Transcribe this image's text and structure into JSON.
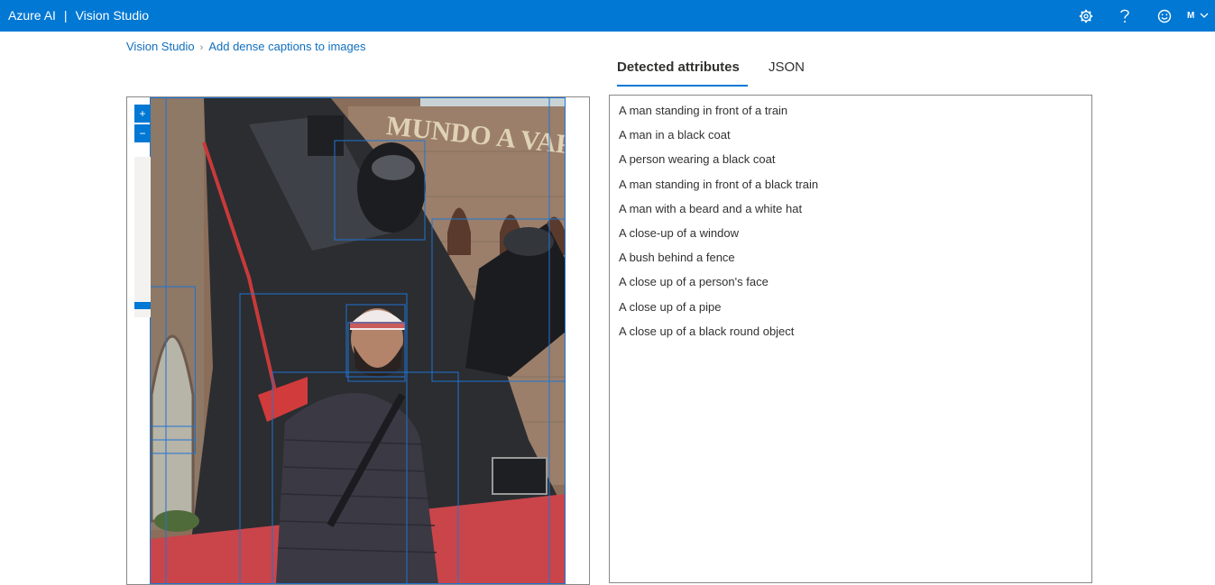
{
  "header": {
    "brand": "Azure AI",
    "separator": "|",
    "product": "Vision Studio",
    "icons": [
      "gear-icon",
      "help-icon",
      "feedback-smiley-icon",
      "chevron-down-icon"
    ],
    "avatar_initial": "M",
    "background_color": "#0078d4"
  },
  "breadcrumb": {
    "items": [
      "Vision Studio",
      "Add dense captions to images"
    ],
    "separator": "›"
  },
  "tabs": {
    "detected": "Detected attributes",
    "json": "JSON",
    "active": "Detected attributes"
  },
  "viewer": {
    "zoom_in_icon": "+",
    "zoom_out_icon": "−",
    "image_sign_text": "MUNDO A VAPOR"
  },
  "captions": [
    "A man standing in front of a train",
    "A man in a black coat",
    "A person wearing a black coat",
    "A man standing in front of a black train",
    "A man with a beard and a white hat",
    "A close-up of a window",
    "A bush behind a fence",
    "A close up of a person's face",
    "A close up of a pipe",
    "A close up of a black round object"
  ],
  "accent_color": "#0078d4"
}
